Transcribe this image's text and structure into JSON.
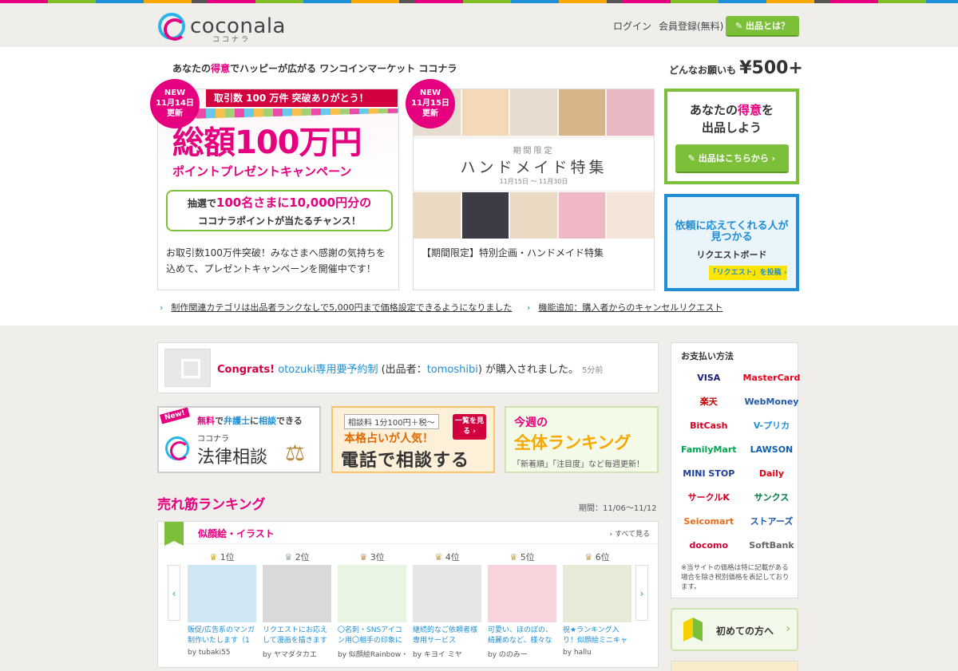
{
  "header": {
    "logo_text": "coconala",
    "logo_sub": "ココナラ",
    "nav": [
      "ログイン",
      "会員登録(無料)"
    ],
    "cta": "✎ 出品とは？"
  },
  "hero": {
    "tagline_pre": "あなたの",
    "tagline_em": "得意",
    "tagline_post": "でハッピーが広がる ワンコインマーケット ココナラ",
    "price_pre": "どんなお願いも",
    "price": "¥500+"
  },
  "cards": [
    {
      "badge": [
        "NEW",
        "11月14日",
        "更新"
      ],
      "ribbon": "取引数 100 万件 突破ありがとう！",
      "big": "総額100万円",
      "sub": "ポイントプレゼントキャンペーン",
      "box_line1_pre": "抽選で",
      "box_line1_num": "100名さまに10,000円分の",
      "box_line2": "ココナラポイントが当たるチャンス！",
      "desc": "お取引数100万件突破！みなさまへ感謝の気持ちを込めて、プレゼントキャンペーンを開催中です！"
    },
    {
      "badge": [
        "NEW",
        "11月15日",
        "更新"
      ],
      "small": "期間限定",
      "title": "ハンドメイド特集",
      "dates": "11月15日 〜 11月30日",
      "desc": "【期間限定】特別企画・ハンドメイド特集"
    }
  ],
  "side": {
    "sell_line1_pre": "あなたの",
    "sell_line1_em": "得意",
    "sell_line1_post": "を",
    "sell_line2": "出品しよう",
    "sell_button": "✎ 出品はこちらから ›",
    "req_line1": "依頼に応えてくれる人が",
    "req_line2": "見つかる",
    "req_sub": "リクエストボード",
    "req_button": "「リクエスト」を投稿 ›"
  },
  "news": [
    "制作関連カテゴリは出品者ランクなしで5,000円まで価格設定できるようになりました",
    "機能追加：購入者からのキャンセルリクエスト"
  ],
  "congrats": {
    "label": "Congrats!",
    "service": "otozuki専用要予約制",
    "seller_pre": " (出品者：",
    "seller": "tomoshibi",
    "seller_post": ") が購入されました。",
    "time": "5分前"
  },
  "promos": {
    "legal": {
      "new": "New!",
      "top_a": "無料",
      "top_b": "で",
      "top_c": "弁護士",
      "top_d": "に",
      "top_e": "相談",
      "top_f": "できる",
      "small": "ココナラ",
      "big": "法律相談"
    },
    "phone": {
      "fee": "相談料 1分100円＋税〜",
      "see": "一覧を見る ›",
      "pop": "本格占いが人気！",
      "big": "電話で相談する"
    },
    "ranking": {
      "week": "今週の",
      "big": "全体ランキング",
      "sub": "「新着順」「注目度」など毎週更新！"
    }
  },
  "ranking": {
    "title": "売れ筋ランキング",
    "period": "期間：11/06〜11/12",
    "category": "似顔絵・イラスト",
    "see_all": "› すべて見る",
    "items": [
      {
        "rank": "1位",
        "title": "販促/広告系のマンガ制作いたします（1ペ",
        "by": "by tubaki55",
        "color": "#cfe6f5"
      },
      {
        "rank": "2位",
        "title": "リクエストにお応えして漫画を描きます【ダ",
        "by": "by ヤマダタカエ",
        "color": "#d9d9d9"
      },
      {
        "rank": "3位",
        "title": "〇名刺・SNSアイコン用〇相手の印象に残",
        "by": "by 似顔絵Rainbow・",
        "color": "#e9f4e2"
      },
      {
        "rank": "4位",
        "title": "継続的なご依頼者様専用サービス",
        "by": "by キヨイ ミヤ",
        "color": "#e6e6e6"
      },
      {
        "rank": "5位",
        "title": "可愛い、ほのぼの、綺麗めなど、様々な雰囲",
        "by": "by ののみー",
        "color": "#f7d3dc"
      },
      {
        "rank": "6位",
        "title": "祝★ランキング入り！似顔絵ミニキャラ(約",
        "by": "by hallu",
        "color": "#e7ecd9"
      }
    ]
  },
  "payment": {
    "heading": "お支払い方法",
    "methods": [
      {
        "name": "VISA",
        "color": "#1a1f71"
      },
      {
        "name": "MasterCard",
        "color": "#eb001b"
      },
      {
        "name": "楽天",
        "color": "#bf0000"
      },
      {
        "name": "WebMoney",
        "color": "#1e5aa8"
      },
      {
        "name": "BitCash",
        "color": "#d30022"
      },
      {
        "name": "V-プリカ",
        "color": "#1e8fd6"
      },
      {
        "name": "FamilyMart",
        "color": "#00a54f"
      },
      {
        "name": "LAWSON",
        "color": "#0b5eb2"
      },
      {
        "name": "MINI STOP",
        "color": "#1e3e9c"
      },
      {
        "name": "Daily",
        "color": "#e60012"
      },
      {
        "name": "サークルK",
        "color": "#d30022"
      },
      {
        "name": "サンクス",
        "color": "#007a3d"
      },
      {
        "name": "Seicomart",
        "color": "#e96b1f"
      },
      {
        "name": "ストアーズ",
        "color": "#1e5aa8"
      },
      {
        "name": "docomo",
        "color": "#cc0033"
      },
      {
        "name": "SoftBank",
        "color": "#666666"
      }
    ],
    "note": "※当サイトの価格は特に記載がある場合を除き税別価格を表記しております。"
  },
  "first_time": "初めての方へ"
}
